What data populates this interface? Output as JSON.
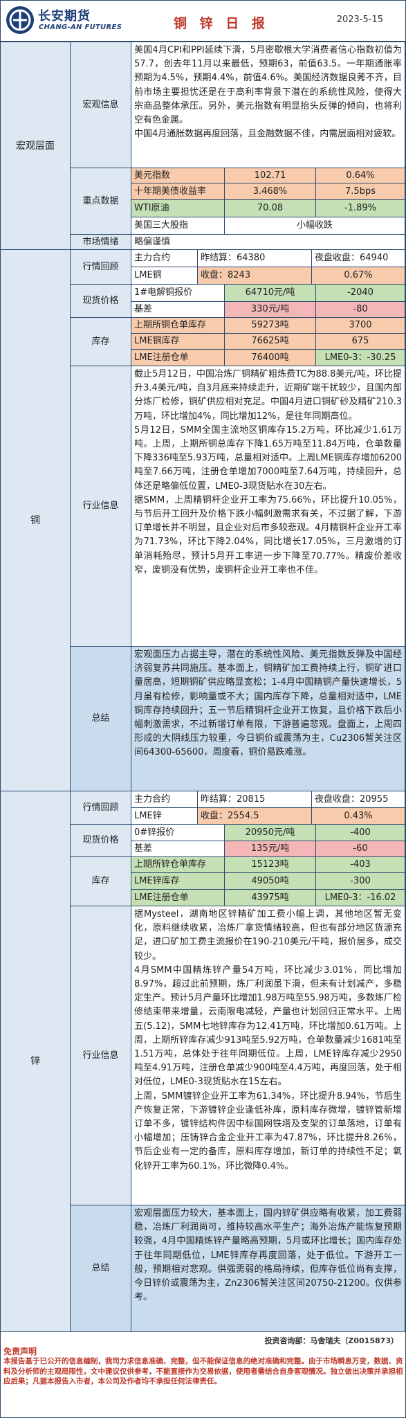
{
  "header": {
    "brand_cn": "长安期货",
    "brand_en": "CHANG-AN FUTURES",
    "title": "铜 锌 日 报",
    "date": "2023-5-15"
  },
  "macro": {
    "section": "宏观层面",
    "info_label": "宏观信息",
    "info_text": "美国4月CPI和PPI延续下滑，5月密歇根大学消费者信心指数初值为57.7，创去年11月以来最低，预期63，前值63.5。一年期通胀率预期为4.5%，预期4.4%，前值4.6%。美国经济数据良莠不齐，目前市场主要担忧还是在于高利率背景下潜在的系统性风险，使得大宗商品整体承压。另外，美元指数有明显抬头反弹的倾向，也将利空有色金属。\n中国4月通胀数据再度回落，且金融数据不佳，内需层面相对疲软。",
    "key_label": "重点数据",
    "key_rows": [
      {
        "name": "美元指数",
        "value": "102.71",
        "change": "0.64%"
      },
      {
        "name": "十年期美债收益率",
        "value": "3.468%",
        "change": "7.5bps"
      },
      {
        "name": "WTI原油",
        "value": "70.08",
        "change": "-1.89%"
      },
      {
        "name": "美国三大股指",
        "value": "小幅收跌"
      }
    ],
    "sentiment_label": "市场情绪",
    "sentiment_value": "略偏谨慎"
  },
  "copper": {
    "section": "铜",
    "quote_label": "行情回顾",
    "quote_rows": [
      [
        "主力合约",
        "昨结算：64380",
        "夜盘收盘：64940"
      ],
      [
        "LME铜",
        "收盘：8243",
        "0.67%"
      ]
    ],
    "spot_label": "现货价格",
    "spot_rows": [
      [
        "1#电解铜报价",
        "64710元/吨",
        "-2040"
      ],
      [
        "基差",
        "330元/吨",
        "-80"
      ]
    ],
    "inv_label": "库存",
    "inv_rows": [
      [
        "上期所铜仓单库存",
        "59273吨",
        "3700"
      ],
      [
        "LME铜库存",
        "76625吨",
        "675"
      ],
      [
        "LME注册仓单",
        "76400吨",
        "LME0-3：-30.25"
      ]
    ],
    "industry_label": "行业信息",
    "industry_text": "截止5月12日，中国冶炼厂铜精矿粗炼费TC为88.8美元/吨，环比提升3.4美元/吨，自3月底来持续走升，近期矿端干扰较少，且国内部分炼厂检修，铜矿供应相对充足。中国4月进口铜矿砂及精矿210.3万吨，环比增加4%，同比增加12%，是往年同期高位。\n5月12日，SMM全国主流地区铜库存15.2万吨，环比减少1.61万吨。上周，上期所铜总库存下降1.65万吨至11.84万吨，仓单数量下降336吨至5.93万吨，总量相对适中。上周LME铜库存增加6200吨至7.66万吨，注册仓单增加7000吨至7.64万吨，持续回升，总体还是略偏低位置，LME0-3现货贴水在30左右。\n据SMM，上周精铜杆企业开工率为75.66%，环比提升10.05%，与节后开工回升及价格下跌小幅刺激需求有关，不过据了解，下游订单增长并不明显，且企业对后市多较悲观。4月精铜杆企业开工率为71.73%，环比下降2.04%，同比增长17.05%，三月激增的订单消耗殆尽，预计5月开工率进一步下降至70.77%。精废价差收窄，废铜没有优势，废铜杆企业开工率也不佳。",
    "summary_label": "总结",
    "summary_text": "宏观面压力占据主导，潜在的系统性风险、美元指数反弹及中国经济弱复苏共同施压。基本面上，铜精矿加工费持续上行，铜矿进口量居高，短期铜矿供应略显宽松；1-4月中国精铜产量快速增长，5月虽有检修，影响量或不大；国内库存下降，总量相对适中，LME铜库存持续回升；五一节后精铜杆企业开工恢复，且价格下跌后小幅刺激需求，不过新增订单有限，下游普遍悲观。盘面上，上周四形成的大阴线压力较重，今日铜价或震荡为主，Cu2306暂关注区间64300-65600，周度看，铜价易跌难涨。"
  },
  "zinc": {
    "section": "锌",
    "quote_label": "行情回顾",
    "quote_rows": [
      [
        "主力合约",
        "昨结算：20815",
        "夜盘收盘：20955"
      ],
      [
        "LME锌",
        "收盘：2554.5",
        "0.43%"
      ]
    ],
    "spot_label": "现货价格",
    "spot_rows": [
      [
        "0#锌报价",
        "20950元/吨",
        "-400"
      ],
      [
        "基差",
        "135元/吨",
        "-60"
      ]
    ],
    "inv_label": "库存",
    "inv_rows": [
      [
        "上期所锌仓单库存",
        "15123吨",
        "-403"
      ],
      [
        "LME锌库存",
        "49050吨",
        "-300"
      ],
      [
        "LME注册仓单",
        "43975吨",
        "LME0-3：-16.02"
      ]
    ],
    "industry_label": "行业信息",
    "industry_text": "据Mysteel，湖南地区锌精矿加工费小幅上调，其他地区暂无变化，原料继续收紧，冶炼厂拿货情绪较高，但也有部分地区货源充足，进口矿加工费主流报价在190-210美元/干吨，报价居多，成交较少。\n4月SMM中国精炼锌产量54万吨，环比减少3.01%，同比增加8.97%，超过此前预期，炼厂利润虽下滑，但未有计划减产，多稳定生产。预计5月产量环比增加1.98万吨至55.98万吨，多数炼厂检修结束带来增量，云南限电减轻，产量也计划回归正常水平。上周五(5.12)，SMM七地锌库存为12.41万吨，环比增加0.61万吨。上周，上期所锌库存减少913吨至5.92万吨，仓单数量减少1681吨至1.51万吨，总体处于往年同期低位。上周，LME锌库存减少2950吨至4.91万吨，注册仓单减少900吨至4.4万吨，再度回落，处于相对低位，LME0-3现货贴水在15左右。\n上周，SMM镀锌企业开工率为61.34%，环比提升8.94%，节后生产恢复正常，下游镀锌企业逢低补库，原料库存微增，镀锌管新增订单不多，镀锌结构件因中标国网铁塔及支架的订单落地，订单有小幅增加；压铸锌合金企业开工率为47.87%，环比提升8.26%，节后企业有一定的备库，原料库存增加，新订单的持续性不足；氧化锌开工率为60.1%，环比微降0.4%。",
    "summary_label": "总结",
    "summary_text": "宏观层面压力较大，基本面上，国内锌矿供应略有收紧，加工费弱稳，冶炼厂利润尚可，维持较高水平生产；海外冶炼产能恢复预期较强，4月中国精炼锌产量略高预期，5月或环比增长；国内库存处于往年同期低位，LME锌库存再度回落，处于低位。下游开工一般，预期相对悲观。供强需弱的格局持续，但库存低位尚有支撑，今日锌价或震荡为主，Zn2306暂关注区间20750-21200。仅供参考。"
  },
  "footer": {
    "analyst": "投资咨询部：马舍瑞夫（Z0015873）",
    "disclaimer_title": "免责声明",
    "disclaimer_text": "本报告基于已公开的信息编制，我司力求信息准确、完整，但不能保证信息的绝对准确和完整。由于市场瞬息万变，数据、资料及分析师的主观局限性，文中建议仅供参考，不能直接作为交易依据，使用者需结合自身客观情况。独立做出决策并承担相应后果；凡据本报告入市者，本公司及作者均不承担任何法律责任。"
  },
  "colors": {
    "label_bg": "#dde8f3",
    "green": "#c5e0b4",
    "orange": "#f8cbad",
    "pink": "#f4b6b6",
    "summary_bg": "#c9dcee",
    "border": "#2b4a6f",
    "title_red": "#c0392b",
    "brand_blue": "#1f3e78"
  }
}
